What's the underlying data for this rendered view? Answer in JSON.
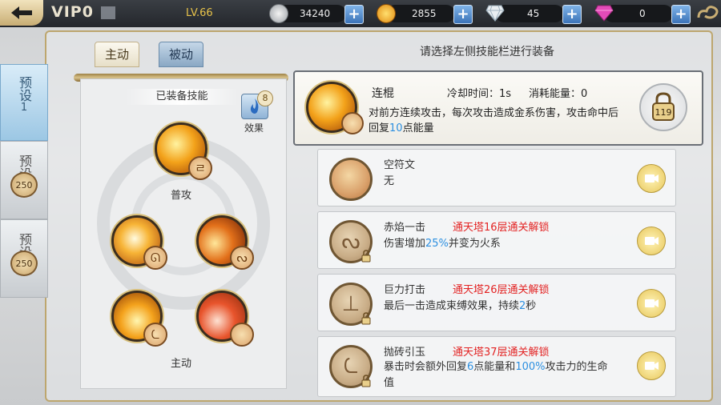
{
  "topbar": {
    "vip": "VIP0",
    "level": "LV.66",
    "resources": [
      {
        "icon": "silver-coin-icon",
        "value": "34240"
      },
      {
        "icon": "gold-ingot-icon",
        "value": "2855"
      },
      {
        "icon": "diamond-icon",
        "value": "45"
      },
      {
        "icon": "pink-gem-icon",
        "value": "0"
      }
    ]
  },
  "side_tabs": {
    "preset1": {
      "label": "预设",
      "num": "1"
    },
    "preset2": {
      "label": "预设",
      "num": "2",
      "cost": "250"
    },
    "preset3": {
      "label": "预设",
      "num": "3",
      "cost": "250"
    }
  },
  "tabs": {
    "active": "主动",
    "passive": "被动"
  },
  "instruction": "请选择左侧技能栏进行装备",
  "left_panel": {
    "title": "已装备技能",
    "effect_label": "效果",
    "effect_count": "8",
    "normal_attack_label": "普攻",
    "active_label": "主动",
    "normal_badge": "ㄹ",
    "skill_badges": [
      "ᘏ",
      "ᔓ",
      "ᘇ",
      ""
    ]
  },
  "detail": {
    "name": "连棍",
    "cooldown_label": "冷却时间：",
    "cooldown_value": "1s",
    "energy_label": "消耗能量：",
    "energy_value": "0",
    "desc_a": "对前方连续攻击，每次攻击造成金系伤害，攻击命中后回复",
    "desc_num": "10",
    "desc_b": "点能量",
    "lock_cost": "119"
  },
  "runes": [
    {
      "name": "空符文",
      "lock_text": "",
      "desc_a": "无",
      "hl": "",
      "desc_b": "",
      "hl2": "",
      "desc_c": "",
      "locked": false
    },
    {
      "name": "赤焰一击",
      "lock_text": "通天塔16层通关解锁",
      "desc_a": "伤害增加",
      "hl": "25%",
      "desc_b": "并变为火系",
      "hl2": "",
      "desc_c": "",
      "locked": true
    },
    {
      "name": "巨力打击",
      "lock_text": "通天塔26层通关解锁",
      "desc_a": "最后一击造成束缚效果，持续",
      "hl": "2",
      "desc_b": "秒",
      "hl2": "",
      "desc_c": "",
      "locked": true
    },
    {
      "name": "抛砖引玉",
      "lock_text": "通天塔37层通关解锁",
      "desc_a": "暴击时会额外回复",
      "hl": "6",
      "desc_b": "点能量和",
      "hl2": "100%",
      "desc_c": "攻击力的生命值",
      "locked": true
    }
  ]
}
